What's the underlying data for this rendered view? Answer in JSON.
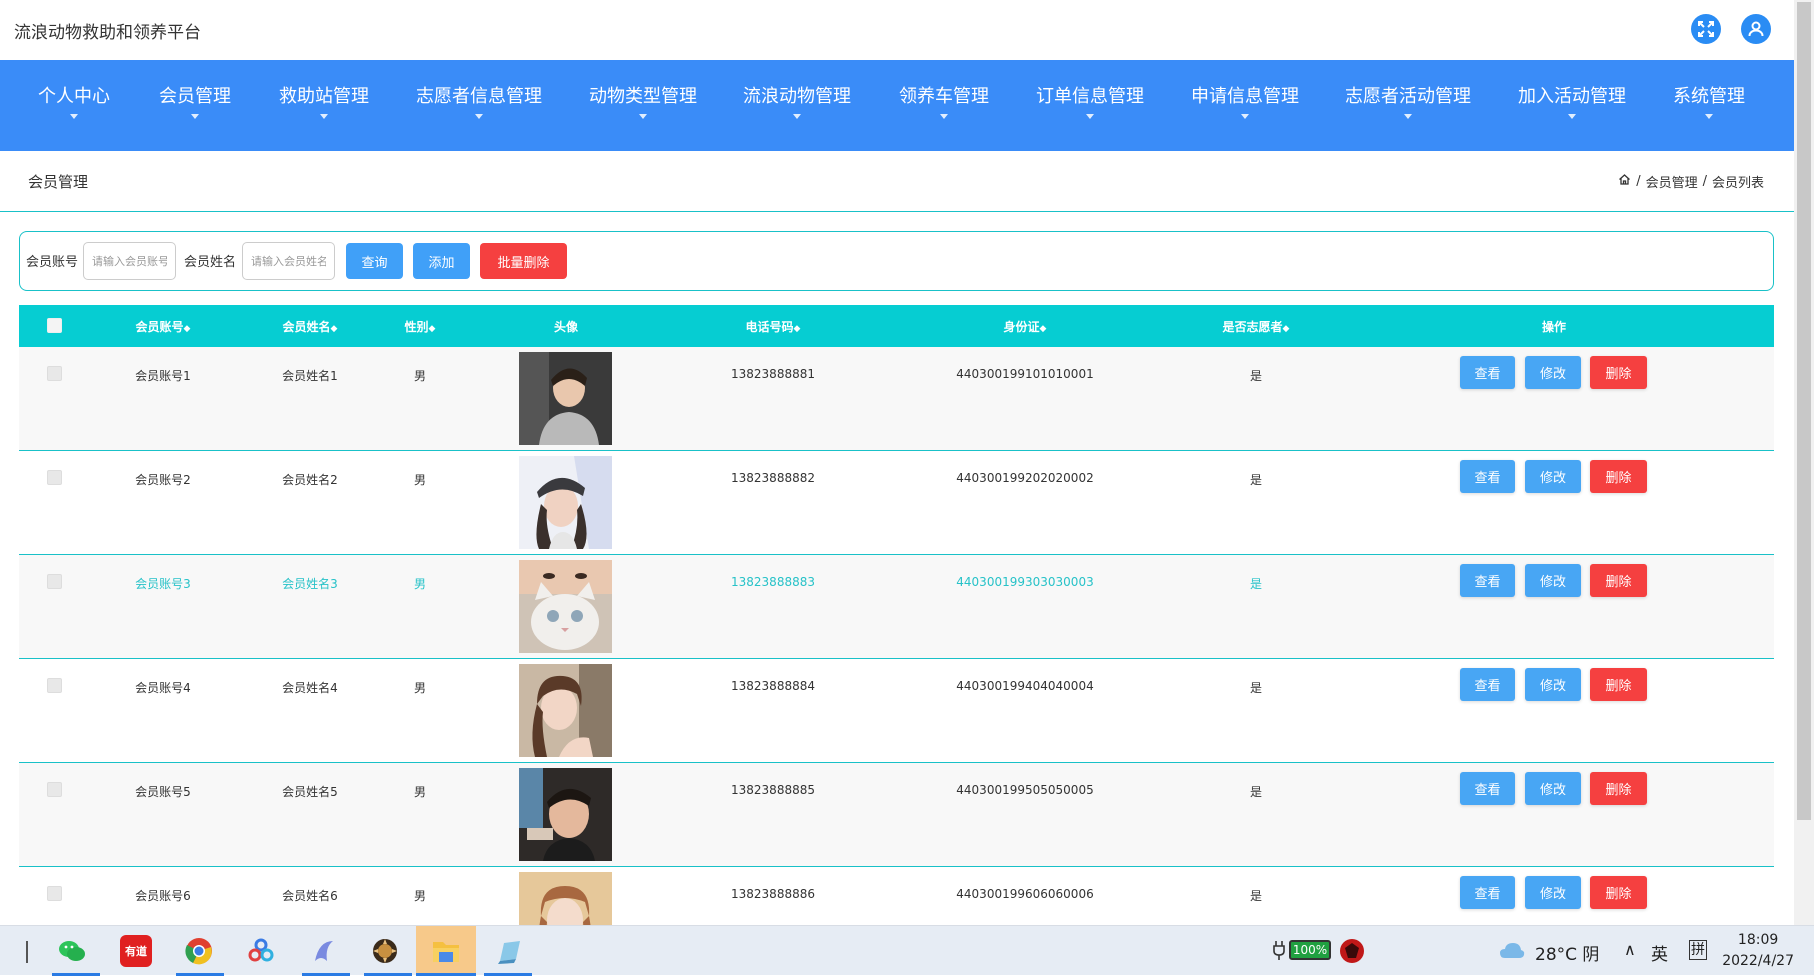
{
  "app": {
    "title": "流浪动物救助和领养平台"
  },
  "nav": {
    "items": [
      {
        "label": "个人中心"
      },
      {
        "label": "会员管理"
      },
      {
        "label": "救助站管理"
      },
      {
        "label": "志愿者信息管理"
      },
      {
        "label": "动物类型管理"
      },
      {
        "label": "流浪动物管理"
      },
      {
        "label": "领养车管理"
      },
      {
        "label": "订单信息管理"
      },
      {
        "label": "申请信息管理"
      },
      {
        "label": "志愿者活动管理"
      },
      {
        "label": "加入活动管理"
      },
      {
        "label": "系统管理"
      }
    ]
  },
  "page": {
    "title": "会员管理",
    "breadcrumb": [
      "会员管理",
      "会员列表"
    ]
  },
  "search": {
    "account_label": "会员账号",
    "account_placeholder": "请输入会员账号",
    "name_label": "会员姓名",
    "name_placeholder": "请输入会员姓名",
    "query_label": "查询",
    "add_label": "添加",
    "batch_delete_label": "批量删除"
  },
  "table": {
    "headers": {
      "account": "会员账号",
      "name": "会员姓名",
      "gender": "性别",
      "avatar": "头像",
      "phone": "电话号码",
      "id_card": "身份证",
      "volunteer": "是否志愿者",
      "ops": "操作"
    },
    "sort_icon": "◆",
    "actions": {
      "view": "查看",
      "edit": "修改",
      "delete": "删除"
    },
    "rows": [
      {
        "account": "会员账号1",
        "name": "会员姓名1",
        "gender": "男",
        "phone": "13823888881",
        "id_card": "440300199101010001",
        "volunteer": "是",
        "avatar": "portrait-photo"
      },
      {
        "account": "会员账号2",
        "name": "会员姓名2",
        "gender": "男",
        "phone": "13823888882",
        "id_card": "440300199202020002",
        "volunteer": "是",
        "avatar": "portrait-photo"
      },
      {
        "account": "会员账号3",
        "name": "会员姓名3",
        "gender": "男",
        "phone": "13823888883",
        "id_card": "440300199303030003",
        "volunteer": "是",
        "avatar": "portrait-photo"
      },
      {
        "account": "会员账号4",
        "name": "会员姓名4",
        "gender": "男",
        "phone": "13823888884",
        "id_card": "440300199404040004",
        "volunteer": "是",
        "avatar": "portrait-photo"
      },
      {
        "account": "会员账号5",
        "name": "会员姓名5",
        "gender": "男",
        "phone": "13823888885",
        "id_card": "440300199505050005",
        "volunteer": "是",
        "avatar": "portrait-photo"
      },
      {
        "account": "会员账号6",
        "name": "会员姓名6",
        "gender": "男",
        "phone": "13823888886",
        "id_card": "440300199606060006",
        "volunteer": "是",
        "avatar": "portrait-photo"
      }
    ]
  },
  "taskbar": {
    "youdao_label": "有道",
    "battery": "100%",
    "weather": "28°C 阴",
    "ime_lang": "英",
    "ime_mode": "拼",
    "time": "18:09",
    "date": "2022/4/27"
  },
  "colors": {
    "nav_bg": "#3a8cf8",
    "table_header_bg": "#06cdd2",
    "accent_cyan": "#19c1c8",
    "button_blue": "#40a0f8",
    "button_red": "#f54040"
  }
}
